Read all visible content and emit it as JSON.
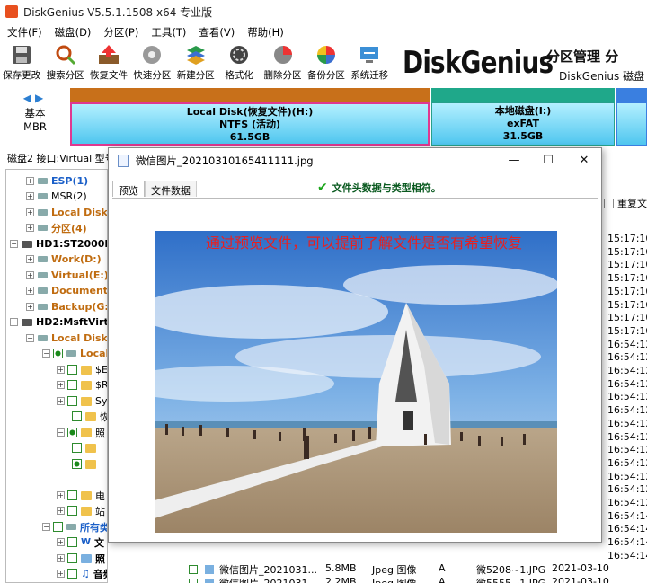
{
  "window": {
    "title": "DiskGenius V5.5.1.1508 x64 专业版"
  },
  "menu": [
    "文件(F)",
    "磁盘(D)",
    "分区(P)",
    "工具(T)",
    "查看(V)",
    "帮助(H)"
  ],
  "toolbar": [
    {
      "label": "保存更改",
      "icon": "save-icon"
    },
    {
      "label": "搜索分区",
      "icon": "search-icon"
    },
    {
      "label": "恢复文件",
      "icon": "recover-icon"
    },
    {
      "label": "快速分区",
      "icon": "quick-partition-icon"
    },
    {
      "label": "新建分区",
      "icon": "new-partition-icon"
    },
    {
      "label": "格式化",
      "icon": "format-icon"
    },
    {
      "label": "删除分区",
      "icon": "delete-partition-icon"
    },
    {
      "label": "备份分区",
      "icon": "backup-partition-icon"
    },
    {
      "label": "系统迁移",
      "icon": "migrate-icon"
    }
  ],
  "banner": {
    "logo": "DiskGenius",
    "line1": "分区管理 分",
    "line2": "DiskGenius 磁盘"
  },
  "disk_map": {
    "mbr_line1": "基本",
    "mbr_line2": "MBR",
    "partitions": [
      {
        "name": "Local Disk(恢复文件)(H:)",
        "fs": "NTFS (活动)",
        "size": "61.5GB"
      },
      {
        "name": "本地磁盘(I:)",
        "fs": "exFAT",
        "size": "31.5GB"
      },
      {
        "name": "",
        "fs": "",
        "size": ""
      }
    ]
  },
  "disk_info": "磁盘2 接口:Virtual  型号",
  "tree": [
    {
      "label": "ESP(1)",
      "style": "b"
    },
    {
      "label": "MSR(2)",
      "style": "n"
    },
    {
      "label": "Local Disk(",
      "style": "v"
    },
    {
      "label": "分区(4)",
      "style": "v"
    },
    {
      "label": "HD1:ST2000DM",
      "style": "k"
    },
    {
      "label": "Work(D:)",
      "style": "v"
    },
    {
      "label": "Virtual(E:)",
      "style": "v"
    },
    {
      "label": "Documents",
      "style": "v"
    },
    {
      "label": "Backup(G:)",
      "style": "v"
    },
    {
      "label": "HD2:MsftVirtu",
      "style": "k"
    },
    {
      "label": "Local Disk(",
      "style": "v"
    },
    {
      "label": "Local",
      "style": "v"
    },
    {
      "label": "$E",
      "style": "n"
    },
    {
      "label": "$R",
      "style": "n"
    },
    {
      "label": "Sy",
      "style": "n"
    },
    {
      "label": "恢",
      "style": "n"
    },
    {
      "label": "照",
      "style": "n"
    },
    {
      "label": "",
      "style": "n"
    },
    {
      "label": "",
      "style": "n"
    },
    {
      "label": "电",
      "style": "n"
    },
    {
      "label": "站",
      "style": "n"
    },
    {
      "label": "所有类",
      "style": "b"
    },
    {
      "label": "文",
      "style": "n"
    },
    {
      "label": "照",
      "style": "n"
    },
    {
      "label": "音频类",
      "style": "k"
    }
  ],
  "right_list": {
    "checkbox_label": "重复文件",
    "times": [
      "15:17:10",
      "15:17:10",
      "15:17:10",
      "15:17:10",
      "15:17:10",
      "15:17:10",
      "15:17:10",
      "15:17:10",
      "16:54:12",
      "16:54:12",
      "16:54:12",
      "16:54:12",
      "16:54:12",
      "16:54:12",
      "16:54:12",
      "16:54:12",
      "16:54:12",
      "16:54:12",
      "16:54:12",
      "16:54:12",
      "16:54:12",
      "16:54:14",
      "16:54:14",
      "16:54:14",
      "16:54:14"
    ]
  },
  "bottom_rows": [
    {
      "name": "微信图片_2021031...",
      "size": "5.8MB",
      "type": "Jpeg 图像",
      "attr": "A",
      "short": "微5208~1.JPG",
      "date": "2021-03-10"
    },
    {
      "name": "微信图片_2021031...",
      "size": "2.2MB",
      "type": "Jpeg 图像",
      "attr": "A",
      "short": "微5555~1.JPG",
      "date": "2021-03-10"
    }
  ],
  "dialog": {
    "title": "微信图片_20210310165411111.jpg",
    "tabs": [
      "预览",
      "文件数据"
    ],
    "status": "文件头数据与类型相符。",
    "overlay": "通过预览文件，可以提前了解文件是否有希望恢复",
    "buttons": {
      "minimize": "—",
      "maximize": "☐",
      "close": "✕"
    }
  },
  "colors": {
    "accent_orange": "#c8701a",
    "partition_fill": "#4fc6ef",
    "selected_border": "#e03890",
    "overlay_text": "#e82020"
  }
}
